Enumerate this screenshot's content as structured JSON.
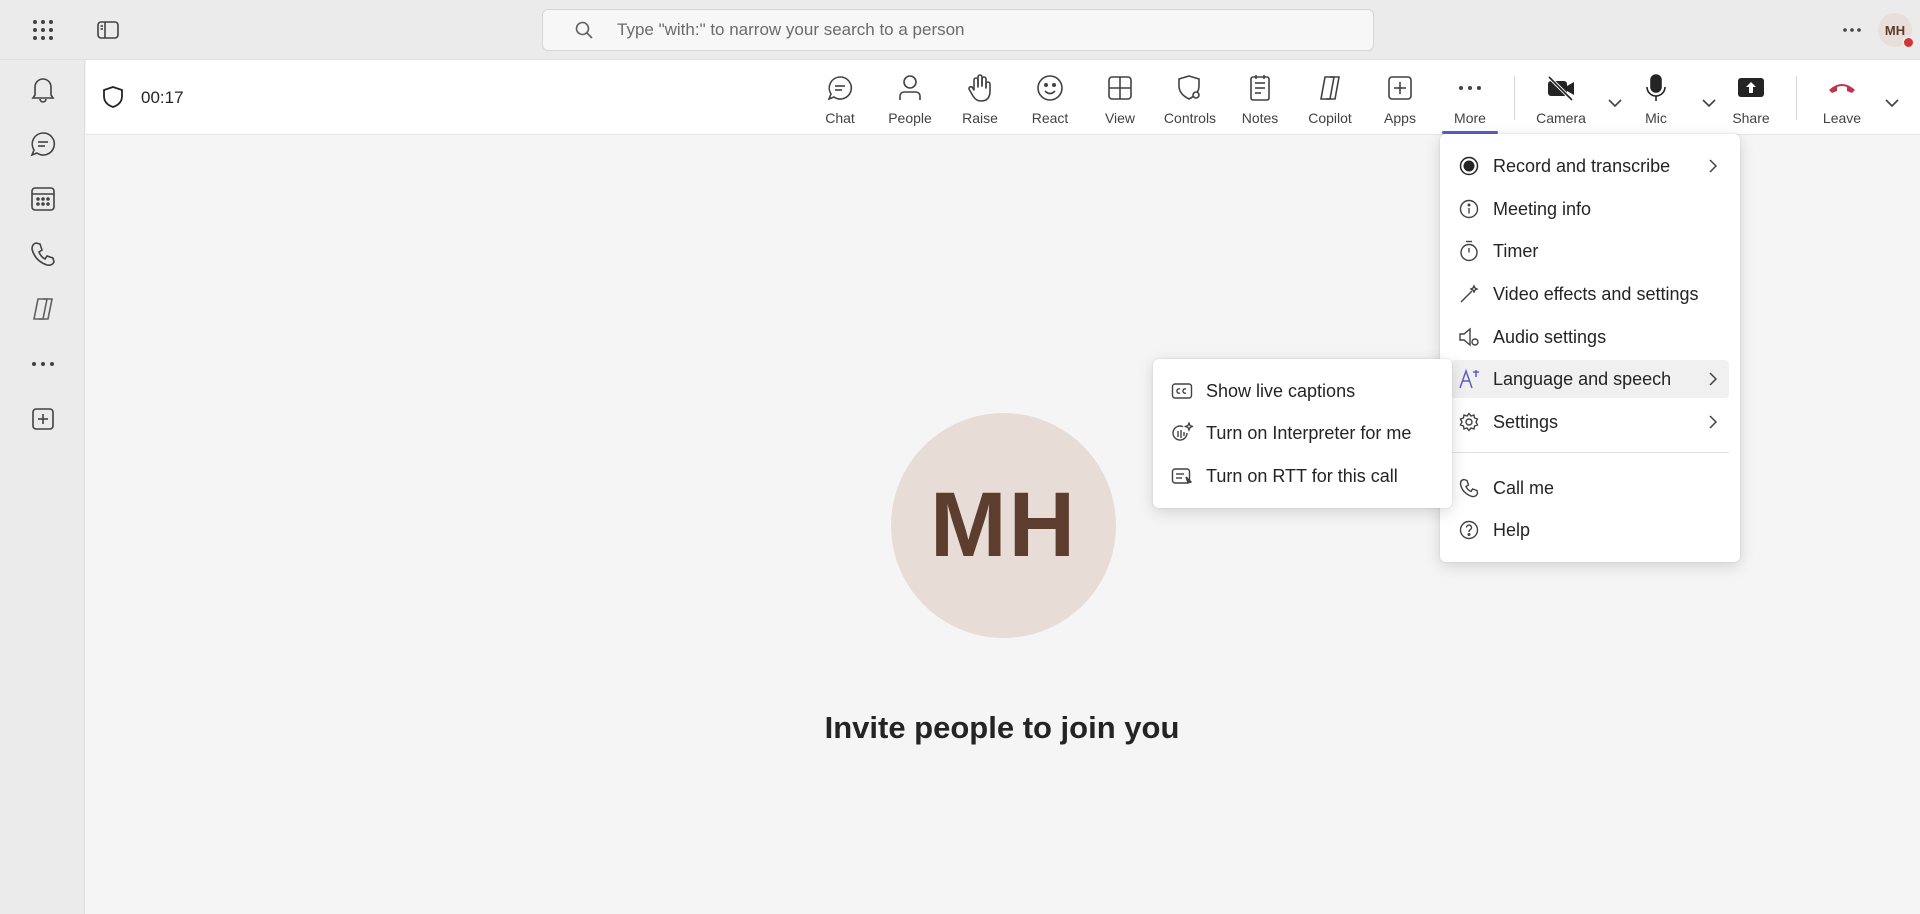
{
  "titlebar": {
    "search_placeholder": "Type \"with:\" to narrow your search to a person",
    "user_initials": "MH"
  },
  "rail": {
    "items": [
      "bell-icon",
      "chat-icon",
      "calendar-icon",
      "phone-icon",
      "copilot-icon",
      "more-icon",
      "add-apps-icon"
    ]
  },
  "meeting": {
    "elapsed": "00:17",
    "tools": [
      {
        "label": "Chat",
        "icon": "chat-icon"
      },
      {
        "label": "People",
        "icon": "people-icon"
      },
      {
        "label": "Raise",
        "icon": "hand-icon"
      },
      {
        "label": "React",
        "icon": "smiley-icon"
      },
      {
        "label": "View",
        "icon": "grid-icon"
      },
      {
        "label": "Controls",
        "icon": "shield-gear-icon"
      },
      {
        "label": "Notes",
        "icon": "notes-icon"
      },
      {
        "label": "Copilot",
        "icon": "copilot-icon"
      },
      {
        "label": "Apps",
        "icon": "add-icon"
      },
      {
        "label": "More",
        "icon": "ellipsis-icon"
      },
      {
        "label": "Camera",
        "icon": "camera-off-icon"
      },
      {
        "label": "Mic",
        "icon": "mic-icon"
      },
      {
        "label": "Share",
        "icon": "share-icon"
      },
      {
        "label": "Leave",
        "icon": "hangup-icon"
      }
    ]
  },
  "stage": {
    "initials": "MH",
    "invite_text": "Invite people to join you"
  },
  "more_menu": {
    "items": [
      {
        "label": "Record and transcribe",
        "icon": "record-icon",
        "submenu": true
      },
      {
        "label": "Meeting info",
        "icon": "info-icon",
        "submenu": false
      },
      {
        "label": "Timer",
        "icon": "stopwatch-icon",
        "submenu": false
      },
      {
        "label": "Video effects and settings",
        "icon": "wand-icon",
        "submenu": false
      },
      {
        "label": "Audio settings",
        "icon": "speaker-gear-icon",
        "submenu": false
      },
      {
        "label": "Language and speech",
        "icon": "language-icon",
        "submenu": true
      },
      {
        "label": "Settings",
        "icon": "gear-icon",
        "submenu": true
      },
      {
        "label": "Call me",
        "icon": "phone-icon",
        "submenu": false
      },
      {
        "label": "Help",
        "icon": "help-icon",
        "submenu": false
      }
    ]
  },
  "language_submenu": {
    "items": [
      {
        "label": "Show live captions",
        "icon": "cc-icon"
      },
      {
        "label": "Turn on Interpreter for me",
        "icon": "interpreter-icon"
      },
      {
        "label": "Turn on RTT for this call",
        "icon": "rtt-icon"
      }
    ]
  },
  "colors": {
    "accent": "#5b5fc7",
    "leave_red": "#c4314b",
    "presence_busy": "#d13438"
  }
}
